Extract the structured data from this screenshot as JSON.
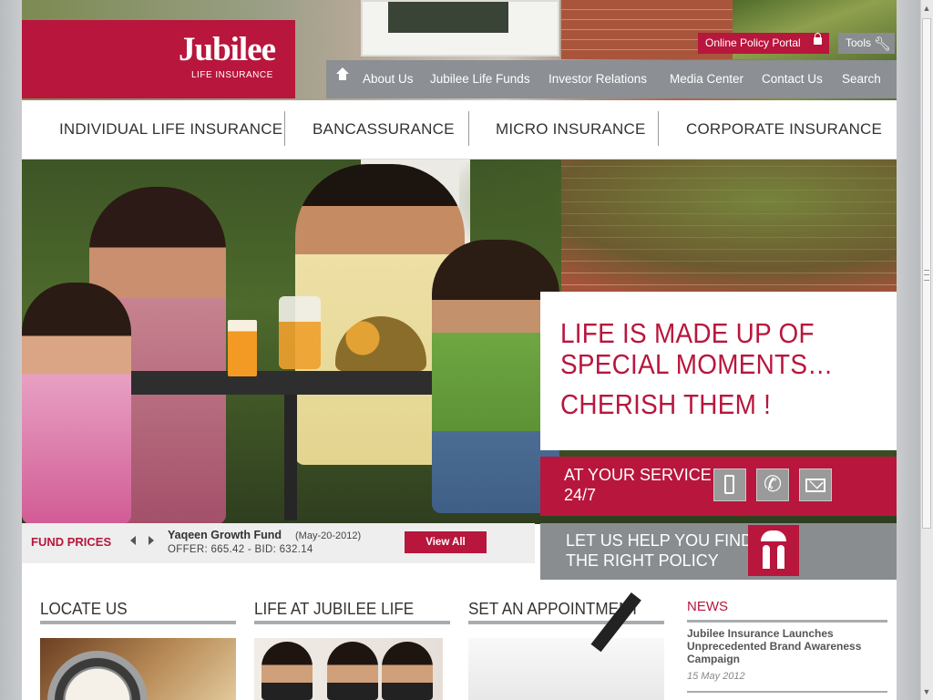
{
  "brand": {
    "logo_word": "Jubilee",
    "logo_sub": "LIFE INSURANCE"
  },
  "utility": {
    "portal": "Online Policy Portal",
    "tools": "Tools"
  },
  "topnav": [
    "About Us",
    "Jubilee Life Funds",
    "Investor Relations",
    "Media Center",
    "Contact Us",
    "Search"
  ],
  "prodnav": [
    "INDIVIDUAL LIFE INSURANCE",
    "BANCASSURANCE",
    "MICRO INSURANCE",
    "CORPORATE INSURANCE"
  ],
  "hero": {
    "line1": "LIFE IS MADE UP OF",
    "line2": "SPECIAL MOMENTS…",
    "line3": "CHERISH THEM !"
  },
  "service": {
    "line1": "AT YOUR SERVICE",
    "line2": "24/7"
  },
  "fund": {
    "label": "FUND PRICES",
    "name": "Yaqeen Growth Fund",
    "date": "(May-20-2012)",
    "values": "OFFER: 665.42 - BID: 632.14",
    "view_all": "View All"
  },
  "help": {
    "line1": "LET US HELP YOU FIND",
    "line2": "THE RIGHT POLICY"
  },
  "sections": [
    "LOCATE US",
    "LIFE AT JUBILEE LIFE",
    "SET AN APPOINTMENT"
  ],
  "news": {
    "title": "NEWS",
    "headline": "Jubilee Insurance Launches Unprecedented Brand Awareness Campaign",
    "date": "15 May 2012"
  },
  "colors": {
    "brand_red": "#b8163c",
    "nav_gray": "#8c8f93"
  }
}
